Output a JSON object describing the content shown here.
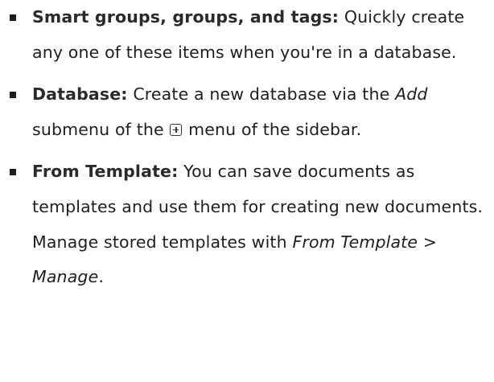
{
  "items": [
    {
      "term": "Smart groups, groups, and tags:",
      "text": "Quickly create any one of these items when you're in a database."
    },
    {
      "term": "Database:",
      "text_before": "Create a new database via the",
      "emph": "Add",
      "text_middle": "submenu of the",
      "icon": "plus-box-icon",
      "text_after": "menu of the sidebar."
    },
    {
      "term": "From Template:",
      "text": "You can save documents as templates and use them for creating new documents. Manage stored templates with",
      "emph": "From Template > Manage",
      "text_after": "."
    }
  ],
  "colors": {
    "text": "#1e1e1e",
    "background": "#ffffff"
  }
}
